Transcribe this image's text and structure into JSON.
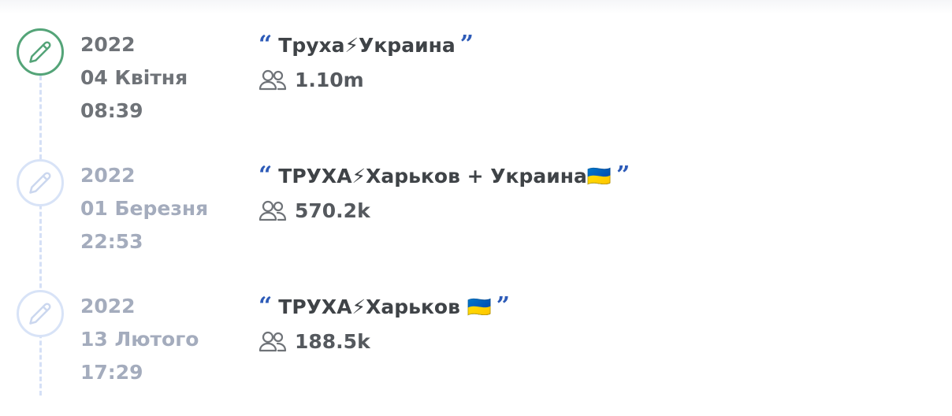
{
  "entries": [
    {
      "state": "active",
      "year": "2022",
      "day_month": "04 Квітня",
      "time": "08:39",
      "title": "Труха⚡Украина",
      "members": "1.10m",
      "marker_icon": "pencil-icon"
    },
    {
      "state": "inactive",
      "year": "2022",
      "day_month": "01 Березня",
      "time": "22:53",
      "title": "ТРУХА⚡Харьков + Украина🇺🇦",
      "members": "570.2k",
      "marker_icon": "pencil-icon"
    },
    {
      "state": "inactive",
      "year": "2022",
      "day_month": "13 Лютого",
      "time": "17:29",
      "title": "ТРУХА⚡Харьков 🇺🇦",
      "members": "188.5k",
      "marker_icon": "pencil-icon"
    }
  ],
  "quotes": {
    "open": "“",
    "close": "”"
  },
  "colors": {
    "active_marker": "#54a478",
    "inactive_marker": "#d8e3f7",
    "quote": "#2d5bb8",
    "timeline_line": "#d5e0f6"
  }
}
